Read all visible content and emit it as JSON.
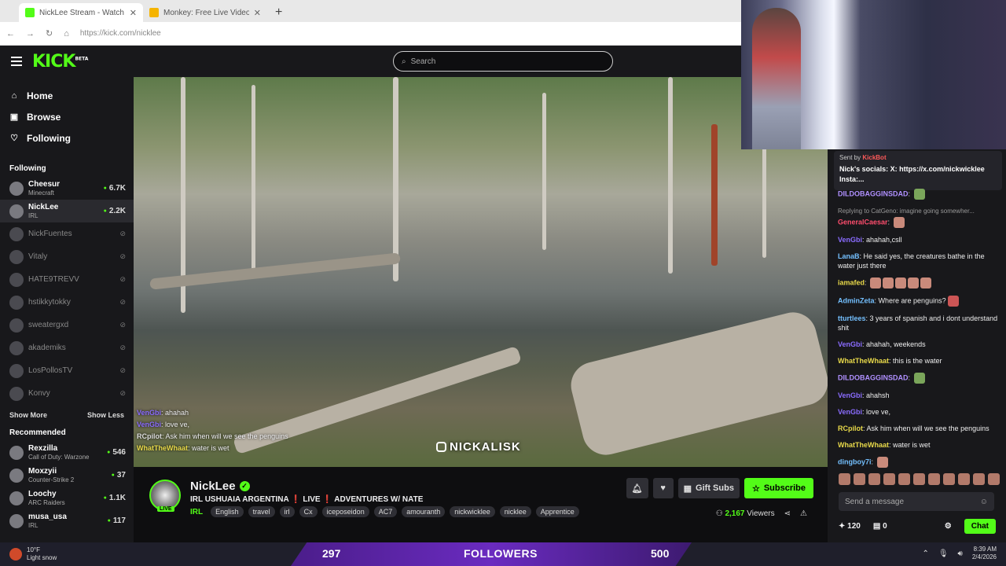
{
  "browser": {
    "tabs": [
      {
        "title": "NickLee Stream - Watch Li",
        "color": "#53fc18",
        "active": true
      },
      {
        "title": "Monkey: Free Live Video Chat",
        "color": "#f5b400",
        "active": false
      }
    ],
    "new_tab": "+",
    "url": "https://kick.com/nicklee"
  },
  "header": {
    "logo": "KICK",
    "logo_badge": "BETA",
    "search_placeholder": "Search"
  },
  "nav": [
    {
      "label": "Home",
      "icon": "home-icon",
      "glyph": "⌂"
    },
    {
      "label": "Browse",
      "icon": "browse-icon",
      "glyph": "▣"
    },
    {
      "label": "Following",
      "icon": "heart-icon",
      "glyph": "♡"
    }
  ],
  "following": {
    "title": "Following",
    "channels": [
      {
        "name": "Cheesur",
        "category": "Minecraft",
        "viewers": "6.7K",
        "live": true
      },
      {
        "name": "NickLee",
        "category": "IRL",
        "viewers": "2.2K",
        "live": true
      },
      {
        "name": "NickFuentes",
        "live": false
      },
      {
        "name": "Vitaly",
        "live": false
      },
      {
        "name": "HATE9TREVV",
        "live": false
      },
      {
        "name": "hstikkytokky",
        "live": false
      },
      {
        "name": "sweatergxd",
        "live": false
      },
      {
        "name": "akademiks",
        "live": false
      },
      {
        "name": "LosPollosTV",
        "live": false
      },
      {
        "name": "Konvy",
        "live": false
      }
    ],
    "show_more": "Show More",
    "show_less": "Show Less"
  },
  "recommended": {
    "title": "Recommended",
    "channels": [
      {
        "name": "Rexzilla",
        "category": "Call of Duty: Warzone",
        "viewers": "546"
      },
      {
        "name": "Moxzyii",
        "category": "Counter-Strike 2",
        "viewers": "37"
      },
      {
        "name": "Loochy",
        "category": "ARC Raiders",
        "viewers": "1.1K"
      },
      {
        "name": "musa_usa",
        "category": "IRL",
        "viewers": "117"
      }
    ]
  },
  "video_overlay": {
    "chat": [
      {
        "user": "VenGbi",
        "text": "ahahah",
        "color": "#8a6cff"
      },
      {
        "user": "VenGbi",
        "text": "love ve,",
        "color": "#8a6cff"
      },
      {
        "user": "RCpilot",
        "text": "Ask him when will we see the penguins",
        "color": "#dddddd"
      },
      {
        "user": "WhatTheWhaat",
        "text": "water is wet",
        "color": "#e8d94a"
      }
    ],
    "watermark": "NICKALISK"
  },
  "stream": {
    "streamer": "NickLee",
    "live_label": "LIVE",
    "title": "IRL USHUAIA ARGENTINA ❗ LIVE ❗ ADVENTURES W/ NATE",
    "category": "IRL",
    "tags": [
      "English",
      "travel",
      "irl",
      "Cx",
      "iceposeidon",
      "AC7",
      "amouranth",
      "nickwicklee",
      "nicklee",
      "Apprentice"
    ],
    "gift_subs": "Gift Subs",
    "subscribe": "Subscribe",
    "viewers": "2,167",
    "viewers_label": "Viewers"
  },
  "chat": {
    "pinned_sent_by": "Sent by",
    "pinned_bot": "KickBot",
    "pinned_message": "Nick's socials: X: https://x.com/nickwicklee Insta:...",
    "messages": [
      {
        "user": "DILDOBAGGINSDAD",
        "text": "",
        "color": "#b090ff",
        "emote": "g"
      },
      {
        "reply": true,
        "text": "Replying to CatGeno: imagine going somewher..."
      },
      {
        "user": "GeneralCaesar",
        "text": "",
        "color": "#ff4d6d",
        "emote": "p"
      },
      {
        "user": "VenGbi",
        "text": "ahahah,csll",
        "color": "#8a6cff"
      },
      {
        "user": "LanaB",
        "text": "He said yes, the creatures bathe in the water just there",
        "color": "#74c0ff"
      },
      {
        "user": "iamafed",
        "text": "",
        "color": "#e8d94a",
        "emote": "row"
      },
      {
        "user": "AdminZeta",
        "text": "Where are penguins?",
        "color": "#74c0ff",
        "emote": "r"
      },
      {
        "user": "tturtlees",
        "text": "3 years of spanish and i dont understand shit",
        "color": "#74c0ff"
      },
      {
        "user": "VenGbi",
        "text": "ahahah, weekends",
        "color": "#8a6cff"
      },
      {
        "user": "WhatTheWhaat",
        "text": "this is the water",
        "color": "#e8d94a"
      },
      {
        "user": "DILDOBAGGINSDAD",
        "text": "",
        "color": "#b090ff",
        "emote": "g"
      },
      {
        "user": "VenGbi",
        "text": "ahahsh",
        "color": "#8a6cff"
      },
      {
        "user": "VenGbi",
        "text": "love ve,",
        "color": "#8a6cff"
      },
      {
        "user": "RCpilot",
        "text": "Ask him when will we see the penguins",
        "color": "#e8d94a"
      },
      {
        "user": "WhatTheWhaat",
        "text": "water is wet",
        "color": "#e8d94a"
      },
      {
        "user": "dingboy7i",
        "text": "",
        "color": "#74c0ff",
        "emote": "p"
      }
    ],
    "input_placeholder": "Send a message",
    "points": "120",
    "extra_count": "0",
    "chat_button": "Chat"
  },
  "taskbar": {
    "temp": "10°F",
    "weather": "Light snow",
    "banner_left": "297",
    "banner_label": "FOLLOWERS",
    "banner_right": "500",
    "time": "8:39 AM",
    "date": "2/4/2026"
  }
}
